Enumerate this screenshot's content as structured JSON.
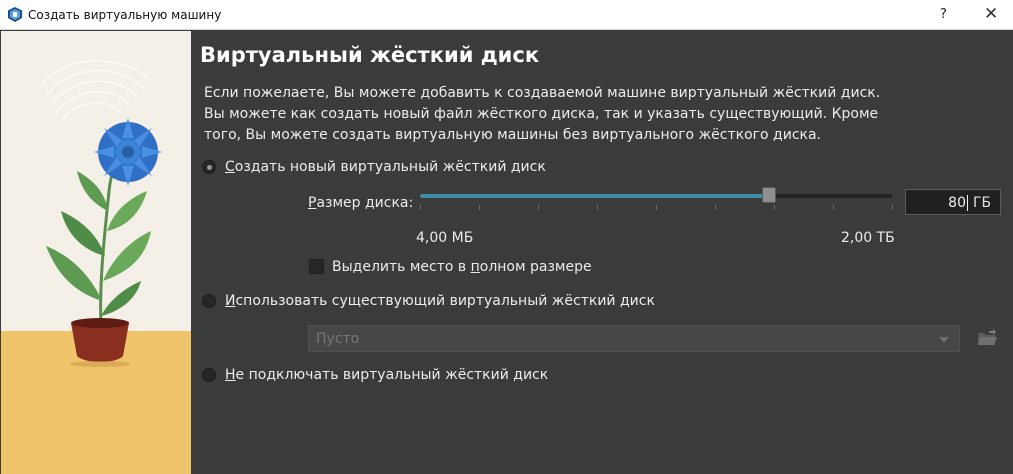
{
  "window": {
    "title": "Создать виртуальную машину",
    "help_label": "?",
    "close_label": "✕"
  },
  "page": {
    "title": "Виртуальный жёсткий диск",
    "description": "Если пожелаете, Вы можете добавить к создаваемой машине виртуальный жёсткий диск. Вы можете как создать новый файл жёсткого диска, так и указать существующий. Кроме того, Вы можете создать виртуальную машины без виртуального жёсткого диска."
  },
  "options": {
    "create_new": {
      "mnemonic": "С",
      "rest": "оздать новый виртуальный жёсткий диск",
      "selected": true
    },
    "use_existing": {
      "mnemonic": "И",
      "rest": "спользовать существующий виртуальный жёсткий диск",
      "selected": false
    },
    "no_disk": {
      "mnemonic": "Н",
      "rest": "е подключать виртуальный жёсткий диск",
      "selected": false
    }
  },
  "disk_size": {
    "label_mnemonic": "Р",
    "label_rest": "азмер диска:",
    "value": "80",
    "unit": "ГБ",
    "min_label": "4,00 МБ",
    "max_label": "2,00 ТБ",
    "slider_fraction": 0.74
  },
  "preallocate": {
    "label_before": "Выделить место в ",
    "label_mnemonic": "п",
    "label_after": "олном размере",
    "checked": false
  },
  "existing_disk": {
    "selected_value": "Пусто"
  },
  "icons": {
    "app": "virtualbox-icon",
    "folder": "folder-open-icon",
    "dropdown": "chevron-down-icon"
  },
  "colors": {
    "accent": "#3f8ea3",
    "background": "#3a3b3b"
  }
}
